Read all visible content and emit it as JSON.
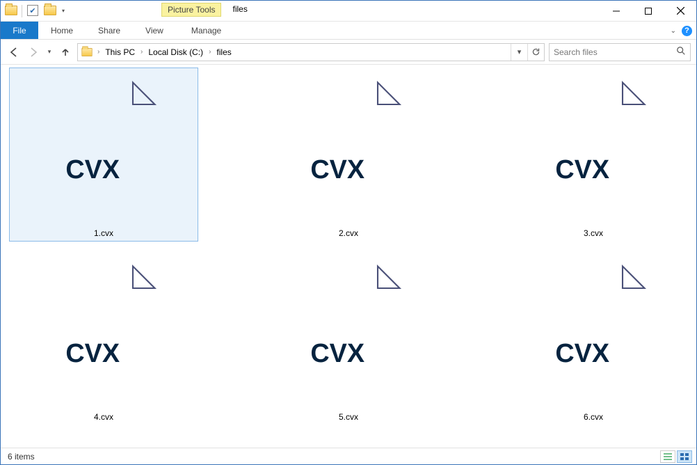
{
  "window": {
    "title": "files",
    "picture_tools_label": "Picture Tools"
  },
  "ribbon": {
    "file": "File",
    "tabs": [
      "Home",
      "Share",
      "View"
    ],
    "contextual_tab": "Manage"
  },
  "address": {
    "segments": [
      "This PC",
      "Local Disk (C:)",
      "files"
    ]
  },
  "search": {
    "placeholder": "Search files"
  },
  "files": [
    {
      "name": "1.cvx",
      "type": "CVX",
      "selected": true
    },
    {
      "name": "2.cvx",
      "type": "CVX",
      "selected": false
    },
    {
      "name": "3.cvx",
      "type": "CVX",
      "selected": false
    },
    {
      "name": "4.cvx",
      "type": "CVX",
      "selected": false
    },
    {
      "name": "5.cvx",
      "type": "CVX",
      "selected": false
    },
    {
      "name": "6.cvx",
      "type": "CVX",
      "selected": false
    }
  ],
  "status": {
    "count_text": "6 items"
  }
}
